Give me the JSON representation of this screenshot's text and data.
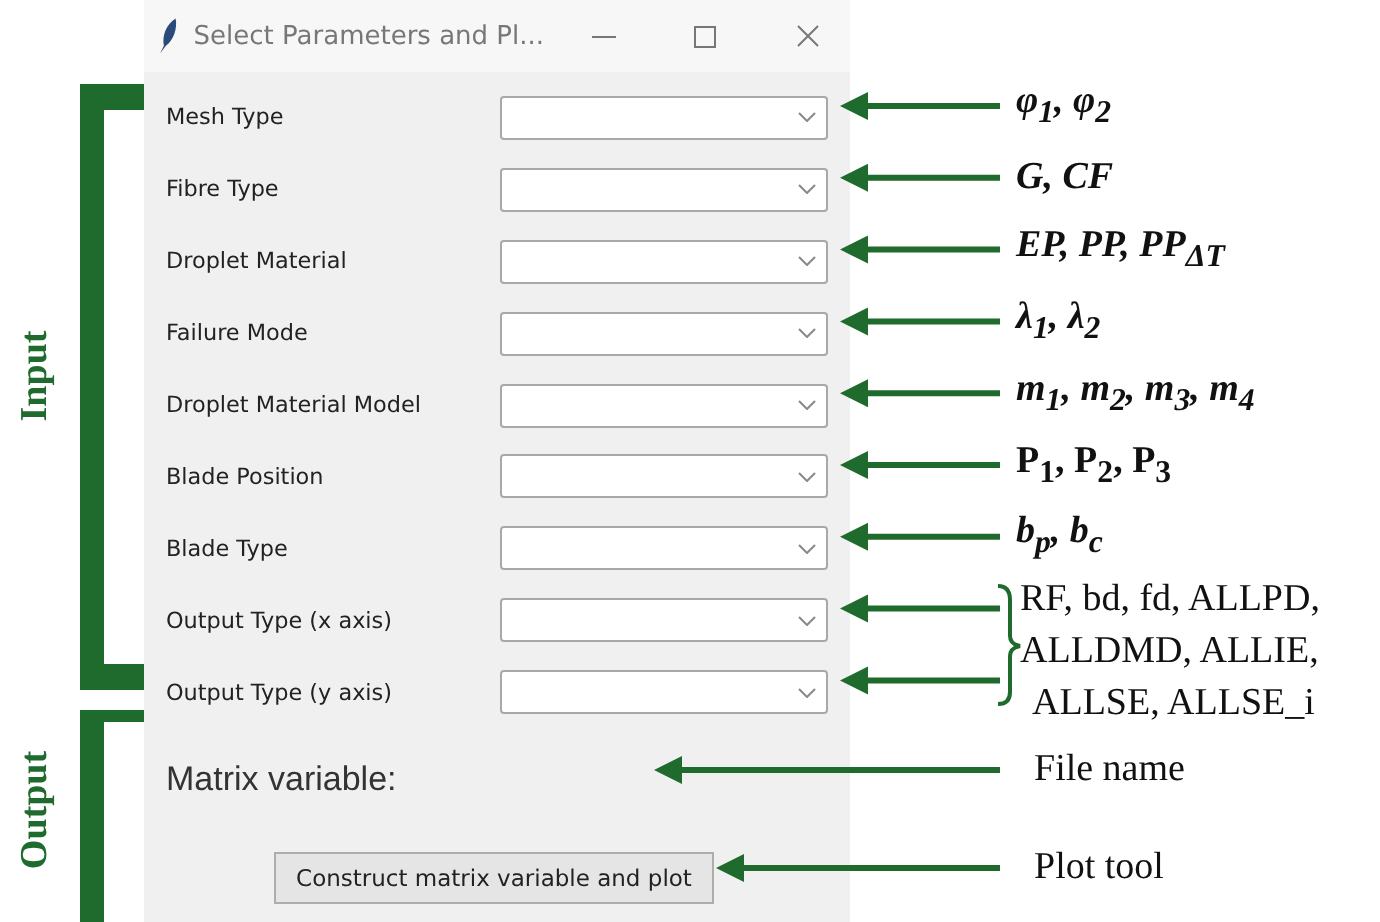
{
  "window": {
    "title": "Select Parameters and Pl...",
    "fields": [
      {
        "label": "Mesh Type"
      },
      {
        "label": "Fibre Type"
      },
      {
        "label": "Droplet Material"
      },
      {
        "label": "Failure Mode"
      },
      {
        "label": "Droplet Material Model"
      },
      {
        "label": "Blade Position"
      },
      {
        "label": "Blade Type"
      },
      {
        "label": "Output Type (x axis)"
      },
      {
        "label": "Output Type (y axis)"
      }
    ],
    "output_label": "Matrix variable:",
    "button": "Construct matrix variable and plot"
  },
  "annotations": {
    "groups": [
      {
        "label": "Input"
      },
      {
        "label": "Output"
      }
    ],
    "notes": [
      {
        "text": "φ$_{1}$, φ$_{2}$",
        "kind": "bold-italic"
      },
      {
        "text": "G, CF",
        "kind": "bold-italic"
      },
      {
        "text": "EP, PP, PP$_{ΔT}$",
        "kind": "bold-italic"
      },
      {
        "text": "λ$_{1}$, λ$_{2}$",
        "kind": "bold-italic"
      },
      {
        "text": "m$_{1}$, m$_{2}$, m$_{3}$, m$_{4}$",
        "kind": "bold-italic"
      },
      {
        "text": "P$_{1}$, P$_{2}$, P$_{3}$",
        "kind": "bold"
      },
      {
        "text": "b$_{p}$, b$_{c}$",
        "kind": "bold-italic"
      }
    ],
    "output_types": [
      "RF, bd, fd, ALLPD,",
      "ALLDMD, ALLIE,",
      "ALLSE, ALLSE_i"
    ],
    "file_note": "File name",
    "plot_note": "Plot tool"
  }
}
